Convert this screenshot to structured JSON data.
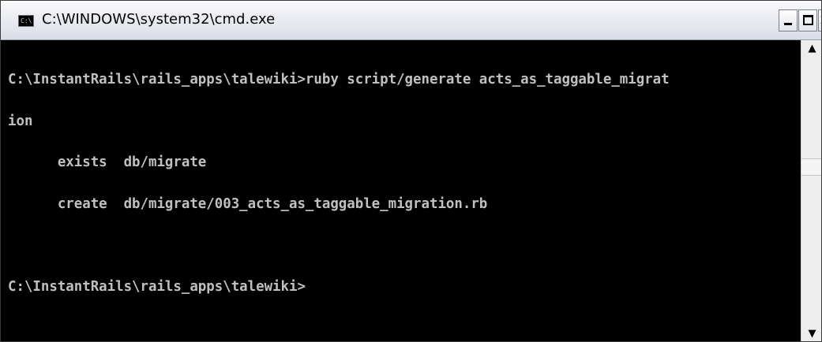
{
  "window": {
    "title": "C:\\WINDOWS\\system32\\cmd.exe",
    "icon": "cmd-console-icon",
    "icon_text": "C:\\"
  },
  "controls": {
    "minimize": "minimize-icon",
    "maximize": "maximize-icon",
    "close": "close-icon"
  },
  "console": {
    "lines": [
      "C:\\InstantRails\\rails_apps\\talewiki>ruby script/generate acts_as_taggable_migrat",
      "ion",
      "      exists  db/migrate",
      "      create  db/migrate/003_acts_as_taggable_migration.rb",
      "",
      "C:\\InstantRails\\rails_apps\\talewiki>"
    ]
  },
  "scrollbar": {
    "up_icon": "scroll-up-arrow-icon",
    "down_icon": "scroll-down-arrow-icon"
  },
  "colors": {
    "console_bg": "#000000",
    "console_text": "#c0c0c0",
    "titlebar": "#e9ebf1"
  }
}
